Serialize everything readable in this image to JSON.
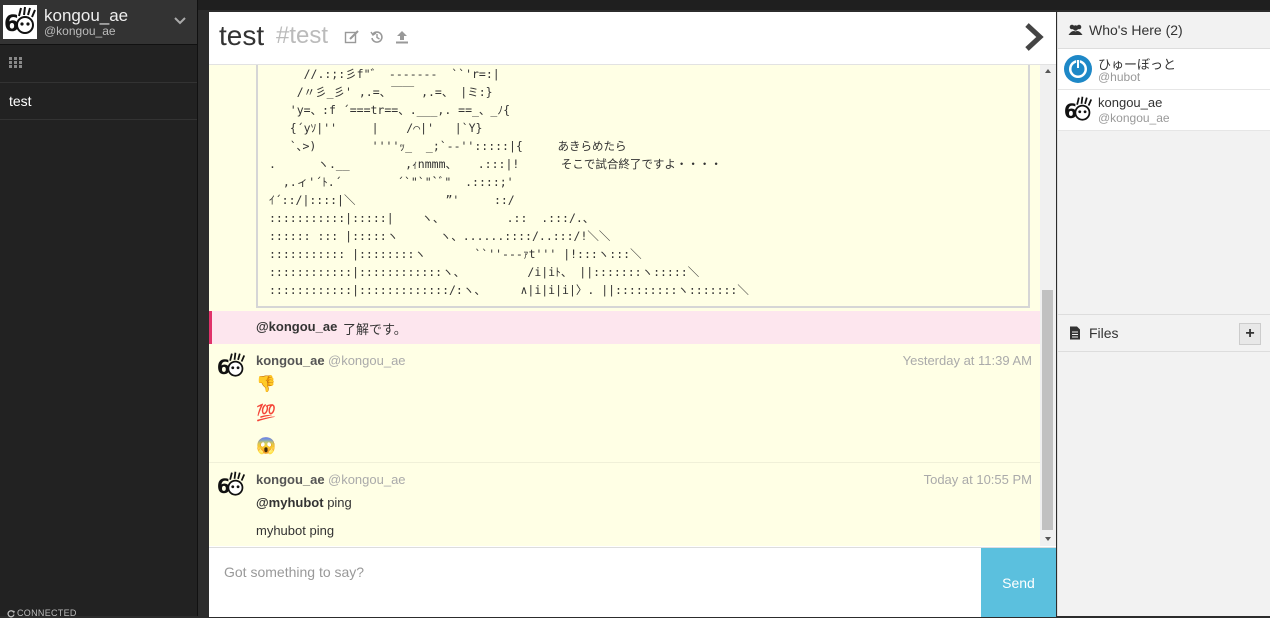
{
  "user": {
    "name": "kongou_ae",
    "handle": "@kongou_ae"
  },
  "sidebar": {
    "rooms": [
      {
        "label": "test"
      }
    ],
    "status": "CONNECTED"
  },
  "room": {
    "title": "test",
    "slug": "#test"
  },
  "art_lines": [
    "     //.:;:彡f\"゛ -------  ``'r=:|",
    "    /〃彡_彡' ,.=、￣￣ ,.=、 |ミ:}",
    "   'y=、:f ´===tr==、.___,. ==_、_ﾉ{",
    "   {´yｿ|''     |    /⌒|'   |`Y}",
    "   `､>)        ''''ｯ_  _;`-‐'':::::|{     あきらめたら",
    ".      ヽ.__        ,ｨnmmm、   .:::|!      そこで試合終了ですよ・・・・",
    "  ,.ィ'´ﾄ.´        ´`\"`\"`ﾞ\"  .::::;'",
    "ｲ´::/|::::|＼             ”'     ::/",
    ":::::::::::|:::::|    ヽ、         .::  .:::/.、",
    ":::::: ::: |:::::ヽ      ヽ、......::::/..:::/!＼＼",
    "::::::::::: |::::::::ヽ       ``''‐--ｧt''' |!:::ヽ:::＼",
    "::::::::::::|::::::::::::ヽ、         /i|iﾄ、 ||:::::::ヽ:::::＼",
    "::::::::::::|:::::::::::::/:ヽ、     ∧|i|i|i|〉. ||:::::::::ヽ:::::::＼"
  ],
  "mention": {
    "user": "@kongou_ae",
    "text": "了解です。"
  },
  "messages": [
    {
      "user": "kongou_ae",
      "handle": "@kongou_ae",
      "time": "Yesterday at 11:39 AM",
      "emojis": [
        "👎",
        "💯",
        "😱"
      ]
    },
    {
      "user": "kongou_ae",
      "handle": "@kongou_ae",
      "time": "Today at 10:55 PM",
      "mention": "@myhubot",
      "text1": "ping",
      "text2": "myhubot ping"
    }
  ],
  "composer": {
    "placeholder": "Got something to say?",
    "send_label": "Send"
  },
  "whos_here": {
    "title": "Who's Here (2)",
    "users": [
      {
        "name": "ひゅーぼっと",
        "handle": "@hubot"
      },
      {
        "name": "kongou_ae",
        "handle": "@kongou_ae"
      }
    ]
  },
  "files": {
    "title": "Files",
    "add_label": "+"
  },
  "colors": {
    "mention_accent": "#e0336a",
    "send_button": "#5bc0de",
    "message_bg": "#ffffe5"
  }
}
